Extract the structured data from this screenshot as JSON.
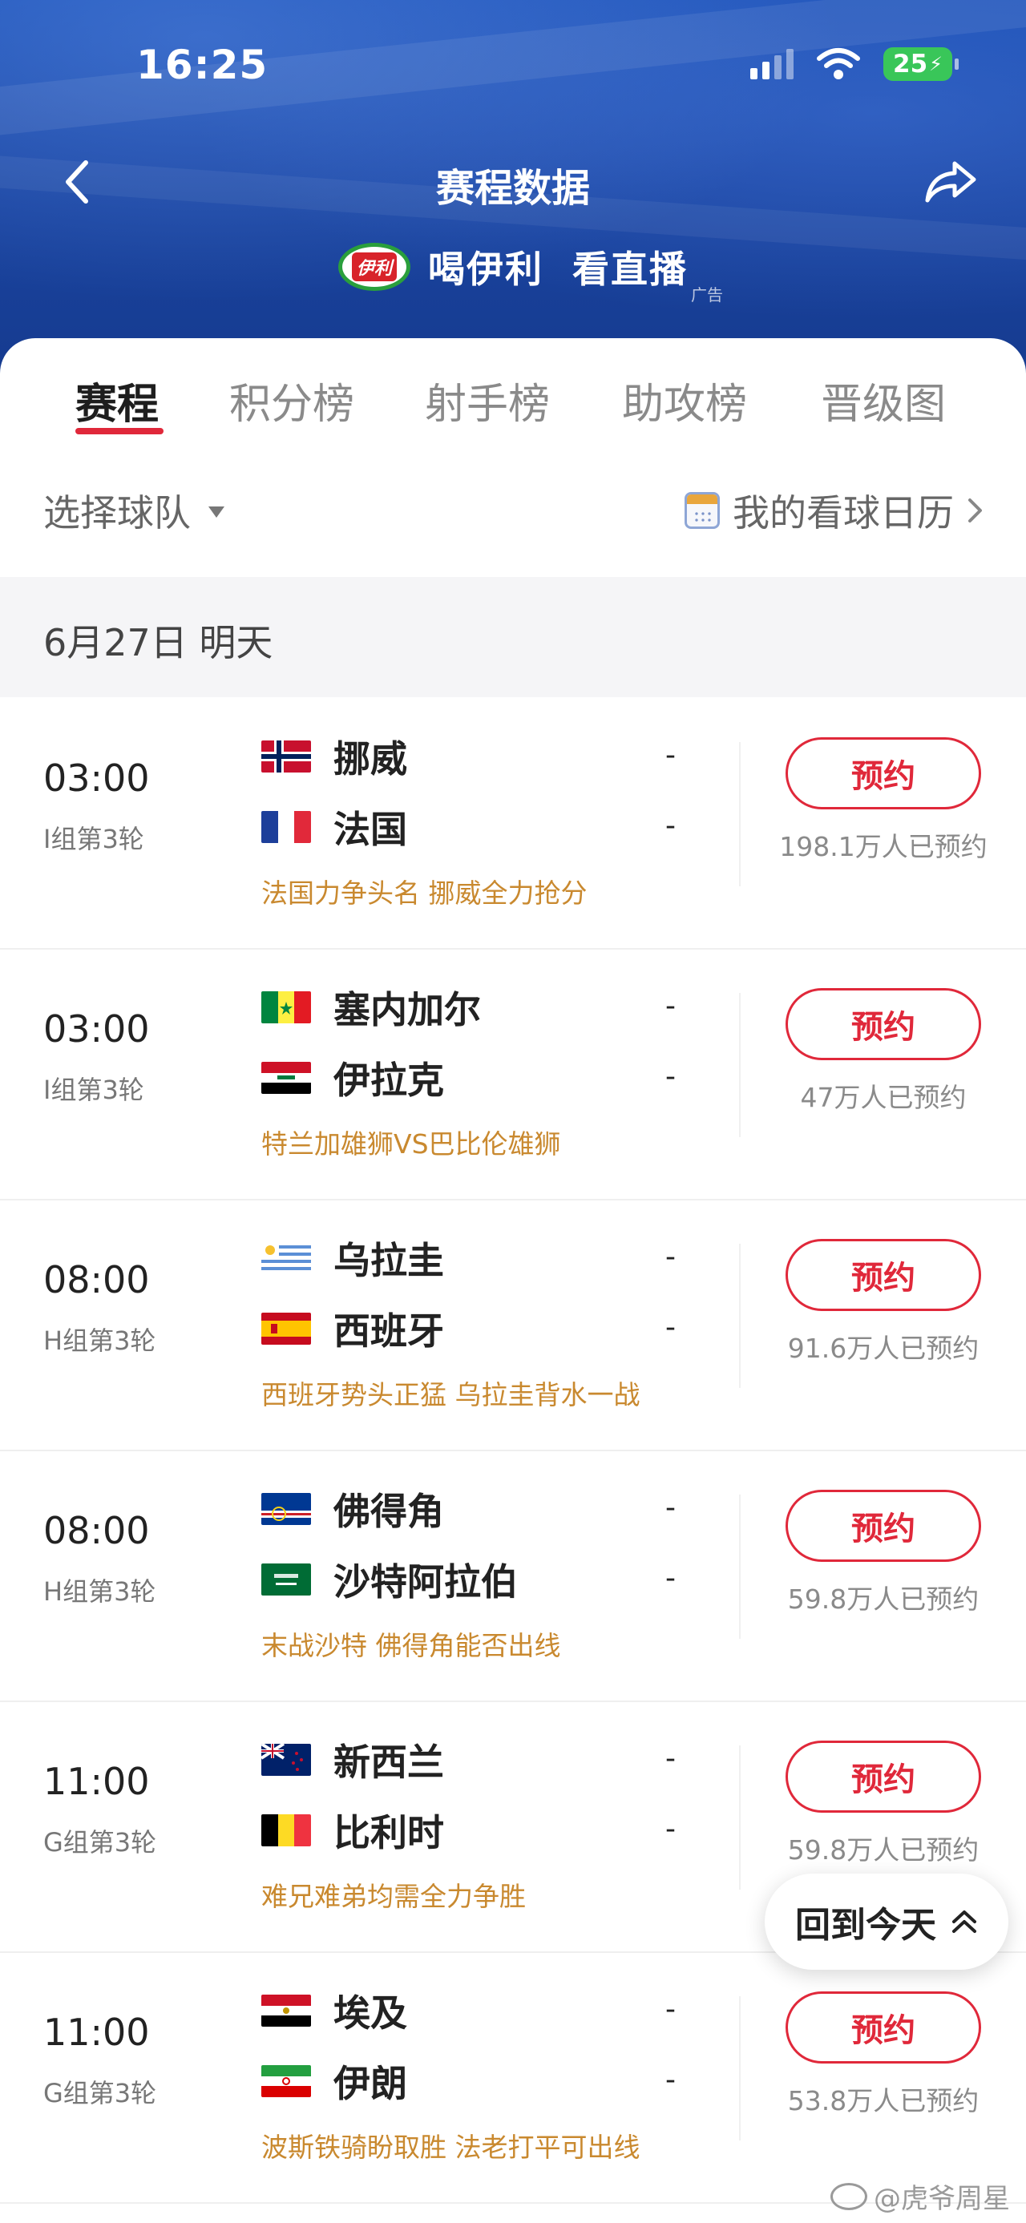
{
  "status_bar": {
    "time": "16:25",
    "battery": "25",
    "signal_icon": "cellular-signal-icon",
    "wifi_icon": "wifi-icon",
    "battery_icon": "battery-charging-icon"
  },
  "nav": {
    "title": "赛程数据",
    "back_icon": "chevron-left-icon",
    "share_icon": "share-icon"
  },
  "ad": {
    "brand": "伊利",
    "text1": "喝伊利",
    "text2": "看直播",
    "tag": "广告"
  },
  "tabs": [
    {
      "label": "赛程",
      "active": true
    },
    {
      "label": "积分榜",
      "active": false
    },
    {
      "label": "射手榜",
      "active": false
    },
    {
      "label": "助攻榜",
      "active": false
    },
    {
      "label": "晋级图",
      "active": false
    }
  ],
  "filter": {
    "team_select": "选择球队",
    "calendar_link": "我的看球日历"
  },
  "date_header": "6月27日  明天",
  "reserve_label": "预约",
  "matches": [
    {
      "time": "03:00",
      "group": "I组第3轮",
      "home": "挪威",
      "away": "法国",
      "home_score": "-",
      "away_score": "-",
      "note": "法国力争头名 挪威全力抢分",
      "reservations": "198.1万人已预约"
    },
    {
      "time": "03:00",
      "group": "I组第3轮",
      "home": "塞内加尔",
      "away": "伊拉克",
      "home_score": "-",
      "away_score": "-",
      "note": "特兰加雄狮VS巴比伦雄狮",
      "reservations": "47万人已预约"
    },
    {
      "time": "08:00",
      "group": "H组第3轮",
      "home": "乌拉圭",
      "away": "西班牙",
      "home_score": "-",
      "away_score": "-",
      "note": "西班牙势头正猛 乌拉圭背水一战",
      "reservations": "91.6万人已预约"
    },
    {
      "time": "08:00",
      "group": "H组第3轮",
      "home": "佛得角",
      "away": "沙特阿拉伯",
      "home_score": "-",
      "away_score": "-",
      "note": "末战沙特 佛得角能否出线",
      "reservations": "59.8万人已预约"
    },
    {
      "time": "11:00",
      "group": "G组第3轮",
      "home": "新西兰",
      "away": "比利时",
      "home_score": "-",
      "away_score": "-",
      "note": "难兄难弟均需全力争胜",
      "reservations": "59.8万人已预约"
    },
    {
      "time": "11:00",
      "group": "G组第3轮",
      "home": "埃及",
      "away": "伊朗",
      "home_score": "-",
      "away_score": "-",
      "note": "波斯铁骑盼取胜 法老打平可出线",
      "reservations": "53.8万人已预约"
    }
  ],
  "flags": [
    "norway-flag-icon",
    "france-flag-icon",
    "senegal-flag-icon",
    "iraq-flag-icon",
    "uruguay-flag-icon",
    "spain-flag-icon",
    "cape-verde-flag-icon",
    "saudi-arabia-flag-icon",
    "new-zealand-flag-icon",
    "belgium-flag-icon",
    "egypt-flag-icon",
    "iran-flag-icon"
  ],
  "back_to_today": "回到今天",
  "watermark": "@虎爷周星",
  "colors": {
    "accent": "#e0283a",
    "note": "#c9892f",
    "header_blue": "#1a45a3"
  }
}
